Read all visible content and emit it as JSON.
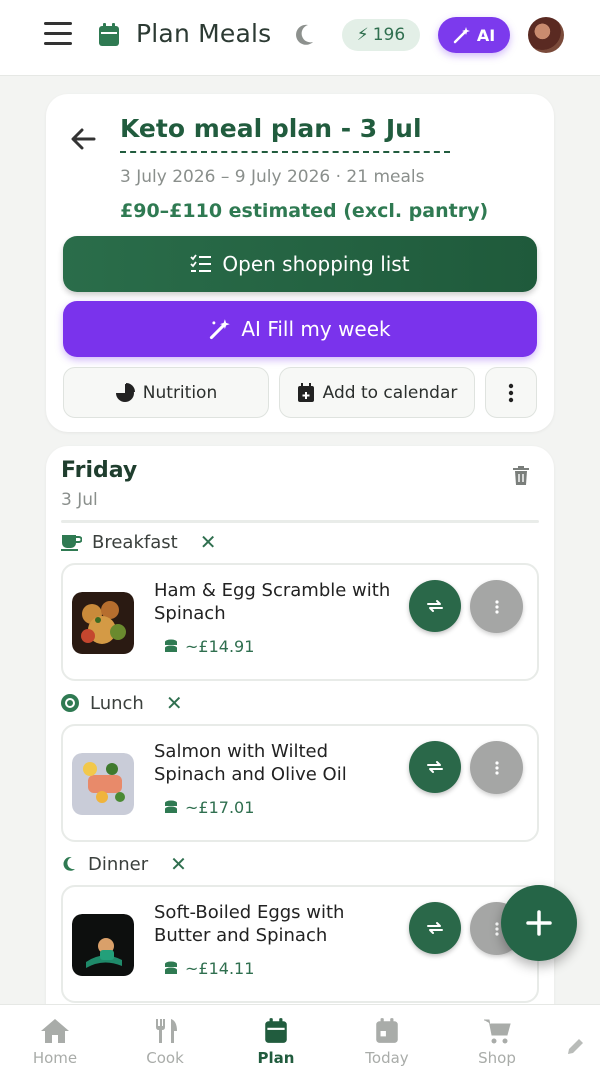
{
  "header": {
    "title": "Plan Meals",
    "credits": "196",
    "ai_label": "AI"
  },
  "plan": {
    "title": "Keto meal plan - 3 Jul",
    "dates": "3 July 2026 – 9 July 2026 · 21 meals",
    "cost": "£90–£110 estimated (excl. pantry)",
    "shopping_label": "Open shopping list",
    "ai_fill_label": "AI Fill my week",
    "nutrition_label": "Nutrition",
    "calendar_label": "Add to calendar"
  },
  "day": {
    "name": "Friday",
    "date": "3 Jul",
    "slots": [
      {
        "label": "Breakfast",
        "meal": "Ham & Egg Scramble with Spinach",
        "price": "~£14.91"
      },
      {
        "label": "Lunch",
        "meal": "Salmon with Wilted Spinach and Olive Oil",
        "price": "~£17.01"
      },
      {
        "label": "Dinner",
        "meal": "Soft-Boiled Eggs with Butter and Spinach",
        "price": "~£14.11"
      }
    ]
  },
  "nav": {
    "items": [
      {
        "label": "Home",
        "icon": "home-icon"
      },
      {
        "label": "Cook",
        "icon": "cutlery-icon"
      },
      {
        "label": "Plan",
        "icon": "calendar-icon",
        "active": true
      },
      {
        "label": "Today",
        "icon": "calendar-today-icon"
      },
      {
        "label": "Shop",
        "icon": "cart-icon"
      }
    ]
  },
  "colors": {
    "brand_green": "#215c3e",
    "ai_purple": "#7c3aed",
    "background": "#f3f4f2"
  }
}
